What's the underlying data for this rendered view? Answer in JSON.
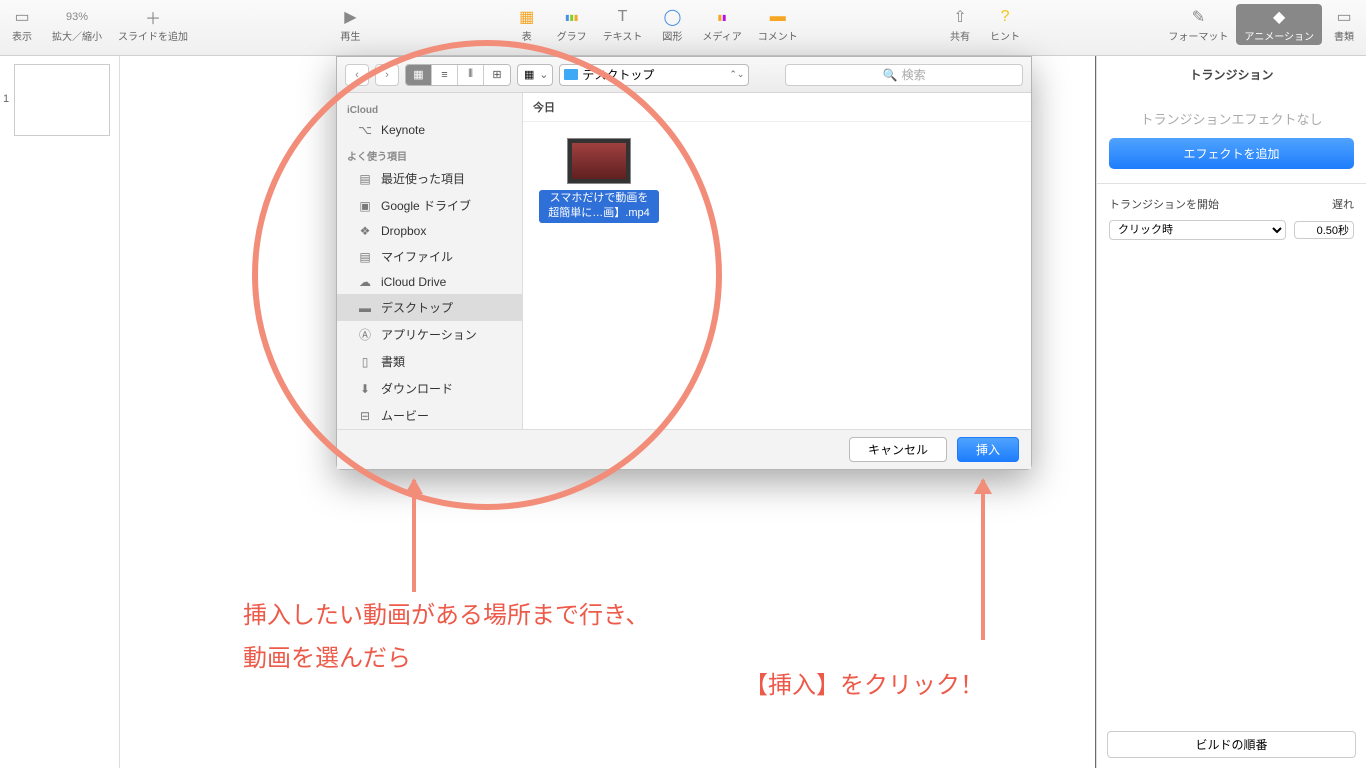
{
  "toolbar": {
    "view": "表示",
    "zoom": "拡大／縮小",
    "zoom_value": "93%",
    "add_slide": "スライドを追加",
    "play": "再生",
    "table": "表",
    "chart": "グラフ",
    "text": "テキスト",
    "shape": "図形",
    "media": "メディア",
    "comment": "コメント",
    "share": "共有",
    "hint": "ヒント",
    "format": "フォーマット",
    "animation": "アニメーション",
    "document": "書類"
  },
  "slide_num": "1",
  "inspector": {
    "title": "トランジション",
    "none": "トランジションエフェクトなし",
    "add_effect": "エフェクトを追加",
    "start_label": "トランジションを開始",
    "delay_label": "遅れ",
    "start_value": "クリック時",
    "delay_value": "0.50秒",
    "build_order": "ビルドの順番"
  },
  "dialog": {
    "location": "デスクトップ",
    "search_placeholder": "検索",
    "sidebar": {
      "icloud_hdr": "iCloud",
      "keynote": "Keynote",
      "fav_hdr": "よく使う項目",
      "recent": "最近使った項目",
      "gdrive": "Google ドライブ",
      "dropbox": "Dropbox",
      "myfiles": "マイファイル",
      "iclouddrive": "iCloud Drive",
      "desktop": "デスクトップ",
      "apps": "アプリケーション",
      "docs": "書類",
      "downloads": "ダウンロード",
      "movies": "ムービー"
    },
    "section_today": "今日",
    "file_name_l1": "スマホだけで動画を",
    "file_name_l2": "超簡単に…画】.mp4",
    "cancel": "キャンセル",
    "insert": "挿入"
  },
  "annotations": {
    "text1": "挿入したい動画がある場所まで行き、\n動画を選んだら",
    "text2": "【挿入】をクリック！"
  }
}
